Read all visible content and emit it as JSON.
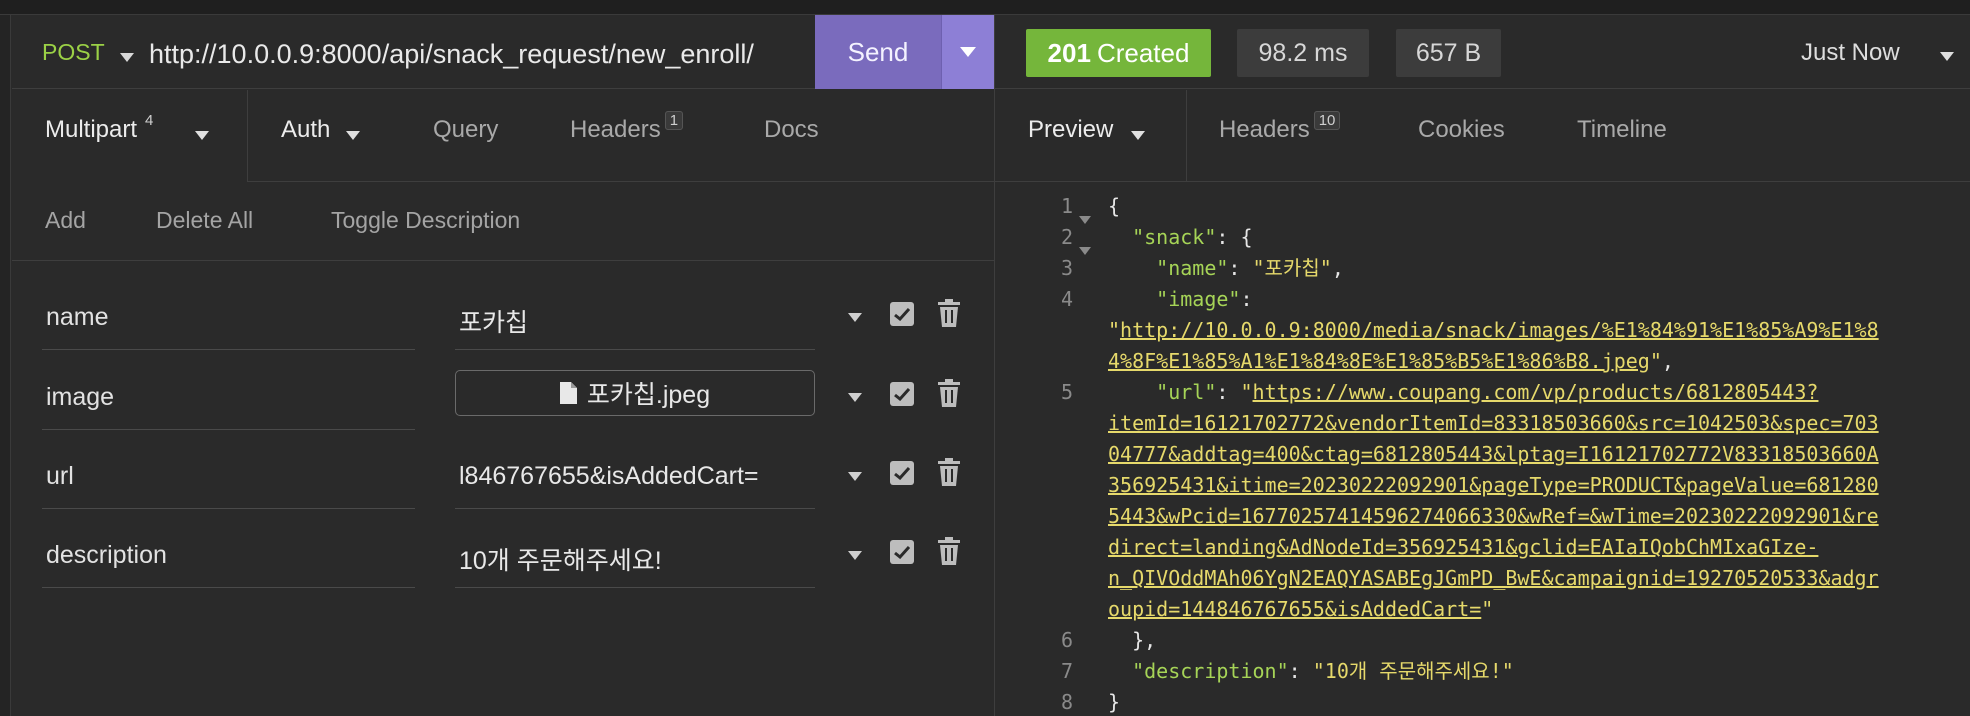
{
  "request": {
    "method": "POST",
    "url": "http://10.0.0.9:8000/api/snack_request/new_enroll/",
    "send_label": "Send"
  },
  "request_tabs": {
    "body": {
      "label": "Multipart",
      "count": "4"
    },
    "auth": "Auth",
    "query": "Query",
    "headers": {
      "label": "Headers",
      "count": "1"
    },
    "docs": "Docs"
  },
  "body_actions": {
    "add": "Add",
    "delete_all": "Delete All",
    "toggle": "Toggle Description"
  },
  "params": [
    {
      "key": "name",
      "value": "포카칩",
      "type": "text"
    },
    {
      "key": "image",
      "value": "포카칩.jpeg",
      "type": "file"
    },
    {
      "key": "url",
      "value": "l846767655&isAddedCart=",
      "type": "text"
    },
    {
      "key": "description",
      "value": "10개 주문해주세요!",
      "type": "text"
    }
  ],
  "response": {
    "status_code": "201",
    "status_text": "Created",
    "time": "98.2 ms",
    "size": "657 B",
    "when": "Just Now"
  },
  "response_tabs": {
    "preview": "Preview",
    "headers": {
      "label": "Headers",
      "count": "10"
    },
    "cookies": "Cookies",
    "timeline": "Timeline"
  },
  "response_body": {
    "line_numbers": [
      "1",
      "2",
      "3",
      "4",
      "5",
      "6",
      "7",
      "8"
    ],
    "open_brace": "{",
    "snack_key": "\"snack\"",
    "snack_open": ": {",
    "name_key": "\"name\"",
    "name_value": "\"포카칩\"",
    "image_key": "\"image\"",
    "image_url_lines": [
      "http://10.0.0.9:8000/media/snack/images/%E1%84%91%E1%85%A9%E1%8",
      "4%8F%E1%85%A1%E1%84%8E%E1%85%B5%E1%86%B8.jpeg"
    ],
    "url_key": "\"url\"",
    "url_lines": [
      "https://www.coupang.com/vp/products/6812805443?",
      "itemId=16121702772&vendorItemId=83318503660&src=1042503&spec=703",
      "04777&addtag=400&ctag=6812805443&lptag=I16121702772V83318503660A",
      "356925431&itime=20230222092901&pageType=PRODUCT&pageValue=681280",
      "5443&wPcid=16770257414596274066330&wRef=&wTime=20230222092901&re",
      "direct=landing&AdNodeId=356925431&gclid=EAIaIQobChMIxaGIze-",
      "n_QIVOddMAh06YgN2EAQYASABEgJGmPD_BwE&campaignid=19270520533&adgr",
      "oupid=144846767655&isAddedCart="
    ],
    "close_inner": "},",
    "description_key": "\"description\"",
    "description_value": "\"10개 주문해주세요!\"",
    "close_brace": "}"
  },
  "colors": {
    "method": "#9bd146",
    "send": "#7a6bbd",
    "status_ok": "#75b63b",
    "json_key": "#a6d457",
    "json_string": "#e6d96b"
  }
}
